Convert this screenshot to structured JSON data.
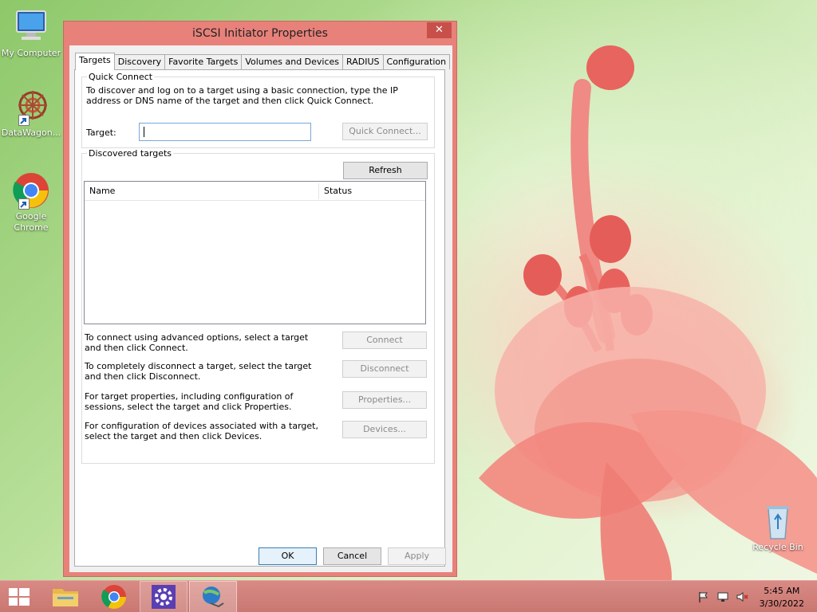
{
  "desktop": {
    "icons": [
      {
        "label": "My Computer"
      },
      {
        "label": "DataWagon..."
      },
      {
        "label": "Google Chrome"
      },
      {
        "label": "Recycle Bin"
      }
    ]
  },
  "dialog": {
    "title": "iSCSI Initiator Properties",
    "close_label": "✕",
    "tabs": [
      {
        "label": "Targets"
      },
      {
        "label": "Discovery"
      },
      {
        "label": "Favorite Targets"
      },
      {
        "label": "Volumes and Devices"
      },
      {
        "label": "RADIUS"
      },
      {
        "label": "Configuration"
      }
    ],
    "quick_connect": {
      "group_title": "Quick Connect",
      "description": "To discover and log on to a target using a basic connection, type the IP address or DNS name of the target and then click Quick Connect.",
      "target_label": "Target:",
      "target_value": "",
      "button": "Quick Connect..."
    },
    "discovered": {
      "group_title": "Discovered targets",
      "refresh_button": "Refresh",
      "columns": [
        "Name",
        "Status"
      ],
      "rows": []
    },
    "actions": [
      {
        "text": "To connect using advanced options, select a target and then click Connect.",
        "button": "Connect"
      },
      {
        "text": "To completely disconnect a target, select the target and then click Disconnect.",
        "button": "Disconnect"
      },
      {
        "text": "For target properties, including configuration of sessions, select the target and click Properties.",
        "button": "Properties..."
      },
      {
        "text": "For configuration of devices associated with a target, select the target and then click Devices.",
        "button": "Devices..."
      }
    ],
    "footer": {
      "ok": "OK",
      "cancel": "Cancel",
      "apply": "Apply"
    }
  },
  "taskbar": {
    "time": "5:45 AM",
    "date": "3/30/2022"
  }
}
